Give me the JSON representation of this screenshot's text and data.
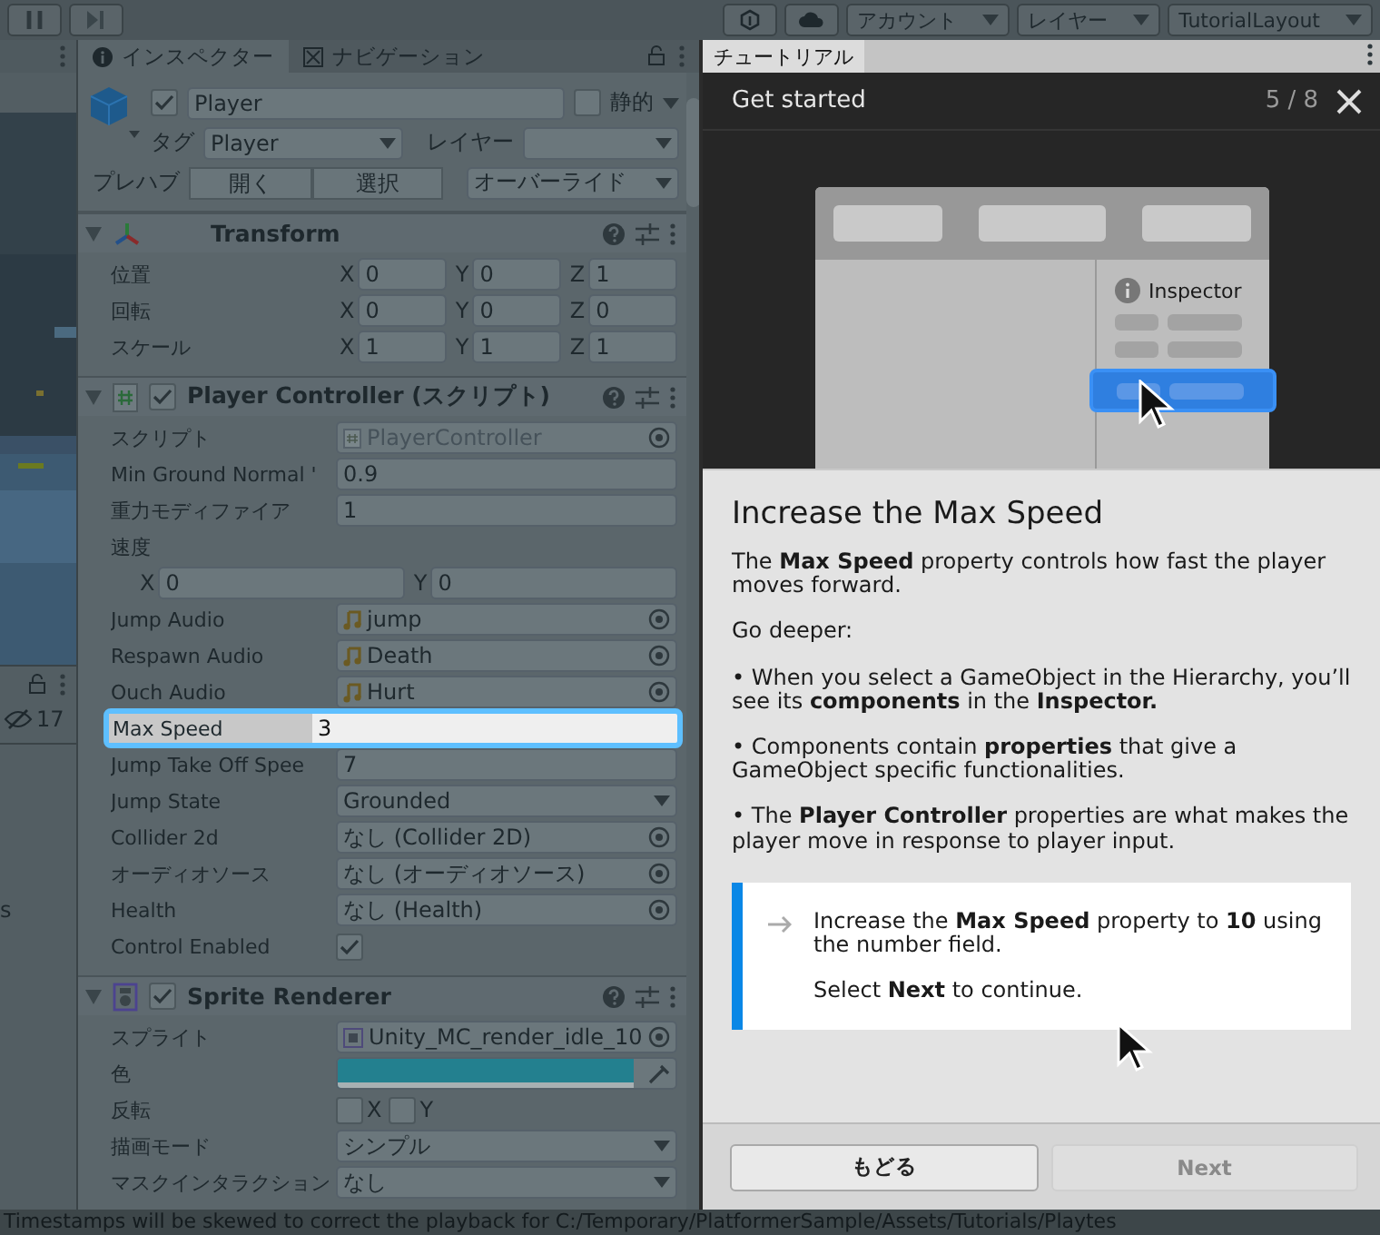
{
  "toolbar": {
    "dropdowns": [
      {
        "label": "アカウント"
      },
      {
        "label": "レイヤー"
      },
      {
        "label": "TutorialLayout"
      }
    ]
  },
  "side_panel": {
    "hidden_count": "17",
    "cut_label": "s"
  },
  "inspector": {
    "tabs": [
      {
        "label": "インスペクター",
        "kind": "info",
        "selected": true
      },
      {
        "label": "ナビゲーション",
        "kind": "nav",
        "selected": false
      }
    ],
    "object": {
      "active": true,
      "name": "Player",
      "static_label": "静的",
      "static": false,
      "tag_label": "タグ",
      "tag": "Player",
      "layer_label": "レイヤー",
      "prefab_label": "プレハブ",
      "prefab_buttons": [
        "開く",
        "選択"
      ],
      "overrides": "オーバーライド"
    },
    "components": [
      {
        "name": "Transform",
        "kind": "transform",
        "expanded": true,
        "rows": [
          {
            "kind": "vector",
            "label": "位置",
            "values": [
              {
                "axis": "X",
                "value": "0"
              },
              {
                "axis": "Y",
                "value": "0"
              },
              {
                "axis": "Z",
                "value": "1"
              }
            ]
          },
          {
            "kind": "vector",
            "label": "回転",
            "values": [
              {
                "axis": "X",
                "value": "0"
              },
              {
                "axis": "Y",
                "value": "0"
              },
              {
                "axis": "Z",
                "value": "0"
              }
            ]
          },
          {
            "kind": "vector",
            "label": "スケール",
            "values": [
              {
                "axis": "X",
                "value": "1"
              },
              {
                "axis": "Y",
                "value": "1"
              },
              {
                "axis": "Z",
                "value": "1"
              }
            ]
          }
        ]
      },
      {
        "name": "Player Controller (スクリプト)",
        "kind": "script",
        "expanded": true,
        "enabled": true,
        "rows": [
          {
            "kind": "script_ref",
            "label": "スクリプト",
            "value": "PlayerController",
            "disabled": true
          },
          {
            "kind": "field",
            "label": "Min Ground Normal '",
            "value": "0.9"
          },
          {
            "kind": "field",
            "label": "重力モディファイア",
            "value": "1"
          },
          {
            "kind": "heading",
            "label": "速度"
          },
          {
            "kind": "vector",
            "values": [
              {
                "axis": "X",
                "value": "0"
              },
              {
                "axis": "Y",
                "value": "0"
              }
            ]
          },
          {
            "kind": "audio_clip",
            "label": "Jump Audio",
            "value": "jump"
          },
          {
            "kind": "audio_clip",
            "label": "Respawn Audio",
            "value": "Death"
          },
          {
            "kind": "audio_clip",
            "label": "Ouch Audio",
            "value": "Hurt"
          },
          {
            "kind": "field",
            "label": "Max Speed",
            "value": "3",
            "highlighted": true
          },
          {
            "kind": "field",
            "label": "Jump Take Off Spee",
            "value": "7"
          },
          {
            "kind": "dropdown",
            "label": "Jump State",
            "value": "Grounded"
          },
          {
            "kind": "object",
            "label": "Collider 2d",
            "value": "なし (Collider 2D)"
          },
          {
            "kind": "object",
            "label": "オーディオソース",
            "value": "なし (オーディオソース)"
          },
          {
            "kind": "object",
            "label": "Health",
            "value": "なし (Health)"
          },
          {
            "kind": "checkbox",
            "label": "Control Enabled",
            "checked": true
          }
        ]
      },
      {
        "name": "Sprite Renderer",
        "kind": "sprite",
        "expanded": true,
        "enabled": true,
        "rows": [
          {
            "kind": "sprite_ref",
            "label": "スプライト",
            "value": "Unity_MC_render_idle_10"
          },
          {
            "kind": "color",
            "label": "色",
            "color": "#23808f"
          },
          {
            "kind": "toggles",
            "label": "反転",
            "toggles": [
              {
                "label": "X",
                "checked": false
              },
              {
                "label": "Y",
                "checked": false
              }
            ]
          },
          {
            "kind": "dropdown",
            "label": "描画モード",
            "value": "シンプル"
          },
          {
            "kind": "dropdown",
            "label": "マスクインタラクション",
            "value": "なし"
          }
        ]
      }
    ]
  },
  "tutorial": {
    "tab": "チュートリアル",
    "title": "Get started",
    "progress": "5 / 8",
    "illustration_label": "Inspector",
    "heading": "Increase the Max Speed",
    "paragraphs": [
      "The **Max Speed** property controls how fast the player moves forward.",
      "Go deeper:",
      "• When you select a GameObject in the Hierarchy, you’ll see its **components** in the **Inspector.**",
      "• Components contain **properties** that give a GameObject specific functionalities.",
      "• The **Player Controller** properties are what makes the player move in response to player input."
    ],
    "instruction": {
      "text": "Increase the **Max Speed** property to **10** using the number field.",
      "note": "Select **Next** to continue."
    },
    "buttons": [
      {
        "label": "もどる",
        "disabled": false
      },
      {
        "label": "Next",
        "disabled": true
      }
    ]
  },
  "status_bar": {
    "message": "Timestamps will be skewed to correct the playback for C:/Temporary/PlatformerSample/Assets/Tutorials/Playtes"
  }
}
